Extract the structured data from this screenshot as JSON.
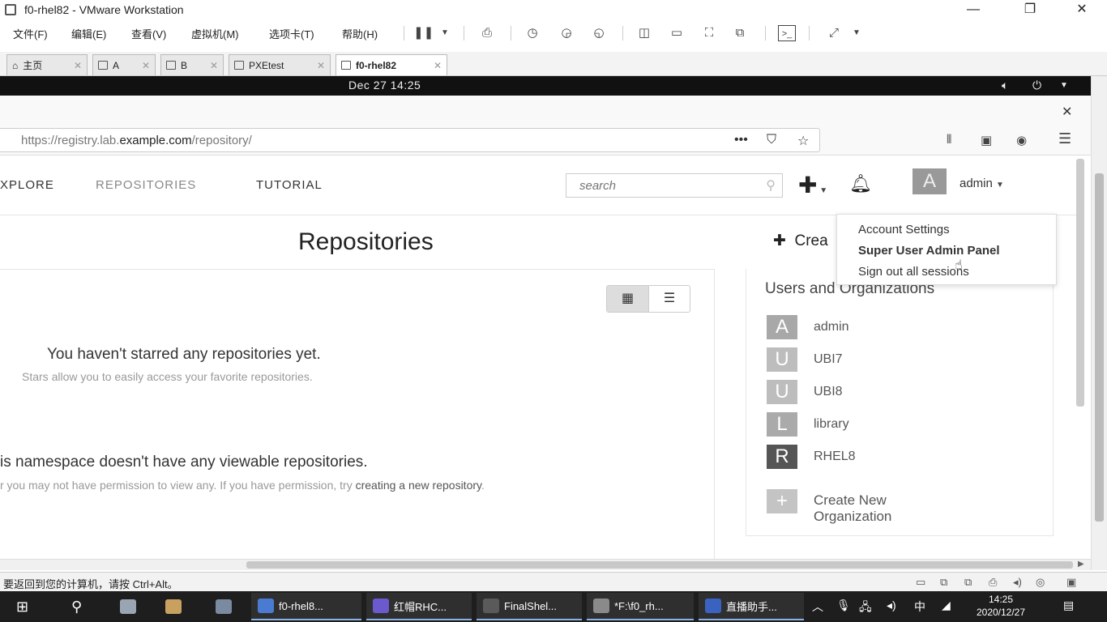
{
  "vmware": {
    "window_title": "f0-rhel82 - VMware Workstation",
    "window_controls": [
      "—",
      "❐",
      "✕"
    ],
    "menu": [
      "文件(F)",
      "编辑(E)",
      "查看(V)",
      "虚拟机(M)",
      "选项卡(T)",
      "帮助(H)"
    ],
    "tabs": [
      {
        "label": "主页",
        "active": false
      },
      {
        "label": "A",
        "active": false
      },
      {
        "label": "B",
        "active": false
      },
      {
        "label": "PXEtest",
        "active": false
      },
      {
        "label": "f0-rhel82",
        "active": true
      }
    ],
    "status_message": "要返回到您的计算机，请按 Ctrl+Alt。"
  },
  "guest": {
    "clock": "Dec 27  14:25"
  },
  "browser": {
    "url_prefix": "https://registry.lab.",
    "url_domain": "example.com",
    "url_suffix": "/repository/",
    "url_more": "•••"
  },
  "nav": {
    "links": [
      "XPLORE",
      "REPOSITORIES",
      "TUTORIAL"
    ],
    "search_placeholder": "search",
    "user_avatar": "A",
    "username": "admin"
  },
  "user_menu": {
    "items": [
      "Account Settings",
      "Super User Admin Panel",
      "Sign out all sessions"
    ]
  },
  "main": {
    "title": "Repositories",
    "starred_heading": "You haven't starred any repositories yet.",
    "starred_sub": "Stars allow you to easily access your favorite repositories.",
    "namespace_heading": "is namespace doesn't have any viewable repositories.",
    "namespace_sub_prefix": "r you may not have permission to view any. If you have permission, try",
    "namespace_link": "creating a new repository",
    "namespace_sub_suffix": "."
  },
  "side": {
    "create_label": "Crea",
    "users_title": "Users and Organizations",
    "orgs": [
      {
        "avatar": "A",
        "name": "admin",
        "color": "#a8a8a8"
      },
      {
        "avatar": "U",
        "name": "UBI7",
        "color": "#bdbdbd"
      },
      {
        "avatar": "U",
        "name": "UBI8",
        "color": "#bdbdbd"
      },
      {
        "avatar": "L",
        "name": "library",
        "color": "#aaaaaa"
      },
      {
        "avatar": "R",
        "name": "RHEL8",
        "color": "#555555"
      }
    ],
    "create_org_avatar": "+",
    "create_org_label": "Create New Organization"
  },
  "taskbar": {
    "items": [
      {
        "label": "f0-rhel8...",
        "color": "#4a7bd0"
      },
      {
        "label": "红帽RHC...",
        "color": "#6a5acd"
      },
      {
        "label": "FinalShel...",
        "color": "#5a5a5a"
      },
      {
        "label": "*F:\\f0_rh...",
        "color": "#8a8a8a"
      },
      {
        "label": "直播助手...",
        "color": "#3a62c0"
      }
    ],
    "tray_lang": "中",
    "time": "14:25",
    "date": "2020/12/27"
  }
}
